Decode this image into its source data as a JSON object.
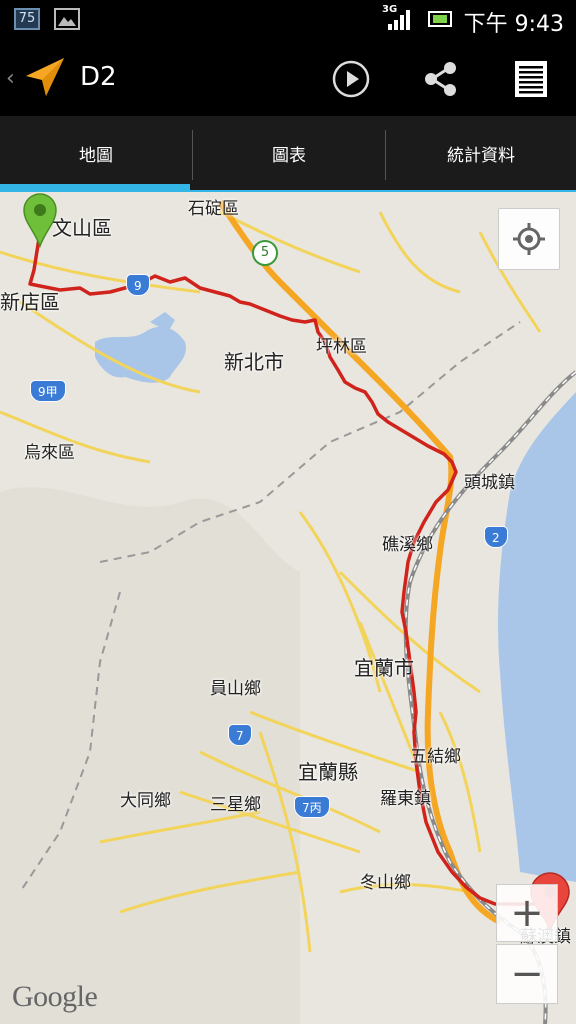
{
  "status_bar": {
    "notification_badge": "75",
    "network": "3G",
    "time": "下午 9:43",
    "icons": [
      "notification-badge-icon",
      "image-icon",
      "signal-icon",
      "battery-icon"
    ]
  },
  "app_bar": {
    "title": "D2",
    "back_icon": "chevron-left-icon",
    "logo_icon": "navigation-arrow-icon",
    "actions": [
      "play-icon",
      "share-icon",
      "menu-icon"
    ]
  },
  "tabs": [
    {
      "label": "地圖",
      "selected": true
    },
    {
      "label": "圖表",
      "selected": false
    },
    {
      "label": "統計資料",
      "selected": false
    }
  ],
  "map": {
    "labels": {
      "wenshan": "文山區",
      "shiding": "石碇區",
      "xindian": "新店區",
      "newtaipei": "新北市",
      "pinglin": "坪林區",
      "wulai": "烏來區",
      "toucheng": "頭城鎮",
      "jiaoxi": "礁溪鄉",
      "yilan_city": "宜蘭市",
      "yuanshan": "員山鄉",
      "wujie": "五結鄉",
      "yilan_county": "宜蘭縣",
      "datong": "大同鄉",
      "sanxing": "三星鄉",
      "luodong": "羅東鎮",
      "dongshan": "冬山鄉",
      "suao": "蘇澳鎮"
    },
    "shields": {
      "route9": "9",
      "route9a": "9甲",
      "route5": "5",
      "route2": "2",
      "route7": "7",
      "route7c": "7丙"
    },
    "start_marker_color": "#6fbf3b",
    "end_marker_color": "#e8453c",
    "track_color": "#d0231c",
    "zoom_in_label": "+",
    "zoom_out_label": "−",
    "attribution": "Google"
  },
  "colors": {
    "accent": "#33b5e5",
    "logo_orange": "#f39c12"
  }
}
